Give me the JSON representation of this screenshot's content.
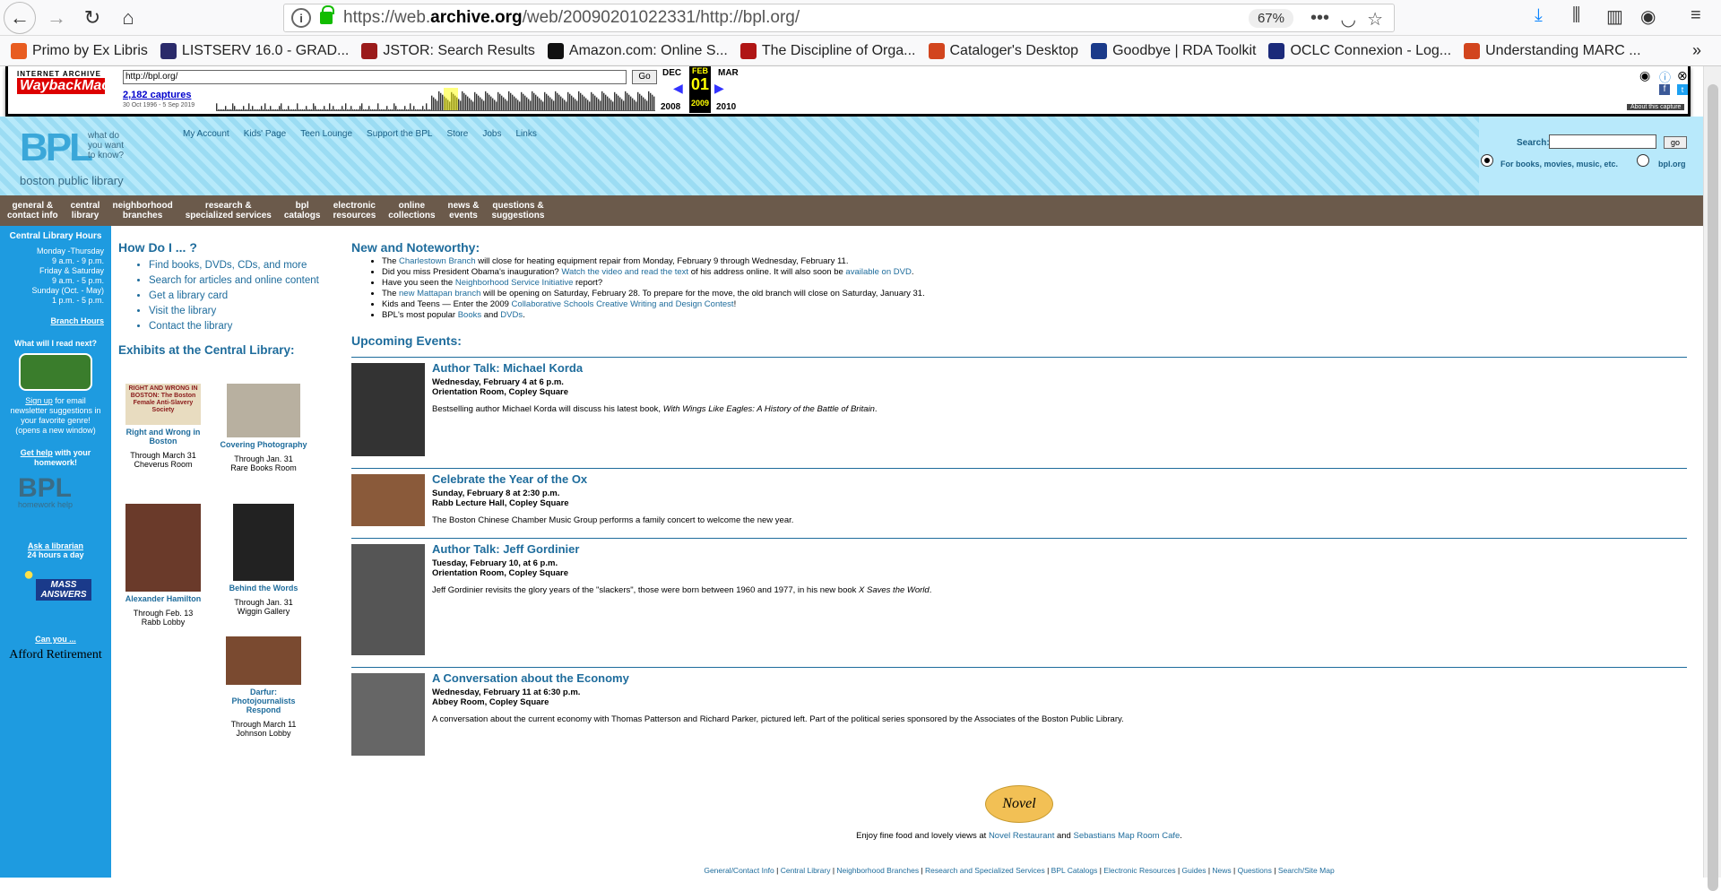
{
  "browser": {
    "url": "https://web.archive.org/web/20090201022331/http://bpl.org/",
    "url_prefix": "https://web.",
    "url_domain": "archive.org",
    "url_rest": "/web/20090201022331/http://bpl.org/",
    "zoom": "67%",
    "bookmarks": [
      {
        "label": "Primo by Ex Libris",
        "color": "#e85c20"
      },
      {
        "label": "LISTSERV 16.0 - GRAD...",
        "color": "#2a2a6a"
      },
      {
        "label": "JSTOR: Search Results",
        "color": "#9b1b1b"
      },
      {
        "label": "Amazon.com: Online S...",
        "color": "#111"
      },
      {
        "label": "The Discipline of Orga...",
        "color": "#b01515"
      },
      {
        "label": "Cataloger's Desktop",
        "color": "#d2451e"
      },
      {
        "label": "Goodbye | RDA Toolkit",
        "color": "#1a3a8a"
      },
      {
        "label": "OCLC Connexion - Log...",
        "color": "#1b2a7a"
      },
      {
        "label": "Understanding MARC ...",
        "color": "#d2451e"
      }
    ]
  },
  "wayback": {
    "logo_top": "INTERNET ARCHIVE",
    "logo_main": "WaybackMachine",
    "input_value": "http://bpl.org/",
    "go": "Go",
    "captures": "2,182 captures",
    "range": "30 Oct 1996 - 5 Sep 2019",
    "prev_month": "DEC",
    "cur_month": "FEB",
    "cur_day": "01",
    "next_month": "MAR",
    "prev_year": "2008",
    "cur_year": "2009",
    "next_year": "2010",
    "about": "About this capture"
  },
  "bpl": {
    "logo": "BPL",
    "tagline": "what do you want to know?",
    "subtitle": "boston public library",
    "toplinks": [
      "My Account",
      "Kids' Page",
      "Teen Lounge",
      "Support the BPL",
      "Store",
      "Jobs",
      "Links"
    ],
    "search_label": "Search:",
    "search_go": "go",
    "radio1": "For books, movies, music, etc.",
    "radio2": "bpl.org",
    "nav": [
      [
        "general &",
        "contact info"
      ],
      [
        "central",
        "library"
      ],
      [
        "neighborhood",
        "branches"
      ],
      [
        "research &",
        "specialized services"
      ],
      [
        "bpl",
        "catalogs"
      ],
      [
        "electronic",
        "resources"
      ],
      [
        "online",
        "collections"
      ],
      [
        "news &",
        "events"
      ],
      [
        "questions &",
        "suggestions"
      ]
    ]
  },
  "sidebar": {
    "hours_title": "Central Library Hours",
    "hours": [
      "Monday -Thursday",
      "9 a.m. - 9 p.m.",
      "Friday & Saturday",
      "9 a.m. - 5 p.m.",
      "Sunday (Oct. - May)",
      "1 p.m. - 5 p.m."
    ],
    "branch_hours": "Branch Hours",
    "read_next": "What will I read next?",
    "signup": "Sign up",
    "signup_rest": "for email newsletter suggestions in your favorite genre! (opens a new window)",
    "get_help": "Get help",
    "get_help_rest": "with your homework!",
    "homework": "homework help",
    "ask": "Ask a librarian",
    "ask_sub": "24 hours a day",
    "mass": "MASS ANSWERS",
    "can_you": "Can you ...",
    "afford": "Afford Retirement"
  },
  "howdo": {
    "title": "How Do I ... ?",
    "items": [
      "Find books, DVDs, CDs, and more",
      "Search for articles and online content",
      "Get a library card",
      "Visit the library",
      "Contact the library"
    ]
  },
  "exhibits": {
    "title": "Exhibits at the Central Library:",
    "items": [
      {
        "title": "Right and Wrong in Boston",
        "dates": "Through March 31",
        "place": "Cheverus Room",
        "thumb_text": "RIGHT AND WRONG IN BOSTON: The Boston Female Anti-Slavery Society"
      },
      {
        "title": "Covering Photography",
        "dates": "Through Jan. 31",
        "place": "Rare Books Room"
      },
      {
        "title": "Alexander Hamilton",
        "dates": "Through Feb. 13",
        "place": "Rabb Lobby"
      },
      {
        "title": "Behind the Words",
        "dates": "Through Jan. 31",
        "place": "Wiggin Gallery"
      },
      {
        "title": "Darfur: Photojournalists Respond",
        "dates": "Through March 11",
        "place": "Johnson Lobby"
      }
    ]
  },
  "news": {
    "title": "New and Noteworthy:",
    "items": [
      {
        "a": "The ",
        "link": "Charlestown Branch",
        "b": " will close for heating equipment repair from Monday, February 9 through Wednesday, February 11.",
        "link2": "",
        "c": ""
      },
      {
        "a": "Did you miss President Obama's inauguration? ",
        "link": "Watch the video and read the text",
        "b": " of his address online. It will also soon be ",
        "link2": "available on DVD",
        "c": "."
      },
      {
        "a": "Have you seen the ",
        "link": "Neighborhood Service Initiative",
        "b": " report?",
        "link2": "",
        "c": ""
      },
      {
        "a": "The ",
        "link": "new Mattapan branch",
        "b": " will be opening on Saturday, February 28. To prepare for the move, the old branch will close on Saturday, January 31.",
        "link2": "",
        "c": ""
      },
      {
        "a": "Kids and Teens — Enter the 2009 ",
        "link": "Collaborative Schools Creative Writing and Design Contest",
        "b": "!",
        "link2": "",
        "c": ""
      },
      {
        "a": "BPL's most popular ",
        "link": "Books",
        "b": " and ",
        "link2": "DVDs",
        "c": "."
      }
    ]
  },
  "events": {
    "title": "Upcoming Events:",
    "items": [
      {
        "title": "Author Talk: Michael Korda",
        "date": "Wednesday, February 4 at 6 p.m.",
        "place": "Orientation Room, Copley Square",
        "desc": "Bestselling author Michael Korda will discuss his latest book, ",
        "desc_i": "With Wings Like Eagles: A History of the Battle of Britain",
        "desc_end": "."
      },
      {
        "title": "Celebrate the Year of the Ox",
        "date": "Sunday, February 8 at 2:30 p.m.",
        "place": "Rabb Lecture Hall, Copley Square",
        "desc": "The Boston Chinese Chamber Music Group performs a family concert to welcome the new year.",
        "desc_i": "",
        "desc_end": ""
      },
      {
        "title": "Author Talk: Jeff Gordinier",
        "date": "Tuesday, February 10, at 6 p.m.",
        "place": "Orientation Room, Copley Square",
        "desc": "Jeff Gordinier revisits the glory years of the \"slackers\", those were born between 1960 and 1977, in his new book ",
        "desc_i": "X Saves the World",
        "desc_end": "."
      },
      {
        "title": "A Conversation about the Economy",
        "date": "Wednesday, February 11 at 6:30 p.m.",
        "place": "Abbey Room, Copley Square",
        "desc": "A conversation about the current economy with Thomas Patterson and Richard Parker, pictured left. Part of the political series sponsored by the Associates of the Boston Public Library.",
        "desc_i": "",
        "desc_end": ""
      }
    ]
  },
  "footer": {
    "novel": "Novel",
    "enjoy": "Enjoy fine food and lovely views at ",
    "novel_link": "Novel Restaurant",
    "and": " and ",
    "cafe_link": "Sebastians Map Room Cafe",
    "dot": ".",
    "links": [
      "General/Contact Info",
      "Central Library",
      "Neighborhood Branches",
      "Research and Specialized Services",
      "BPL Catalogs",
      "Electronic Resources",
      "Guides",
      "News",
      "Questions",
      "Search/Site Map"
    ]
  }
}
